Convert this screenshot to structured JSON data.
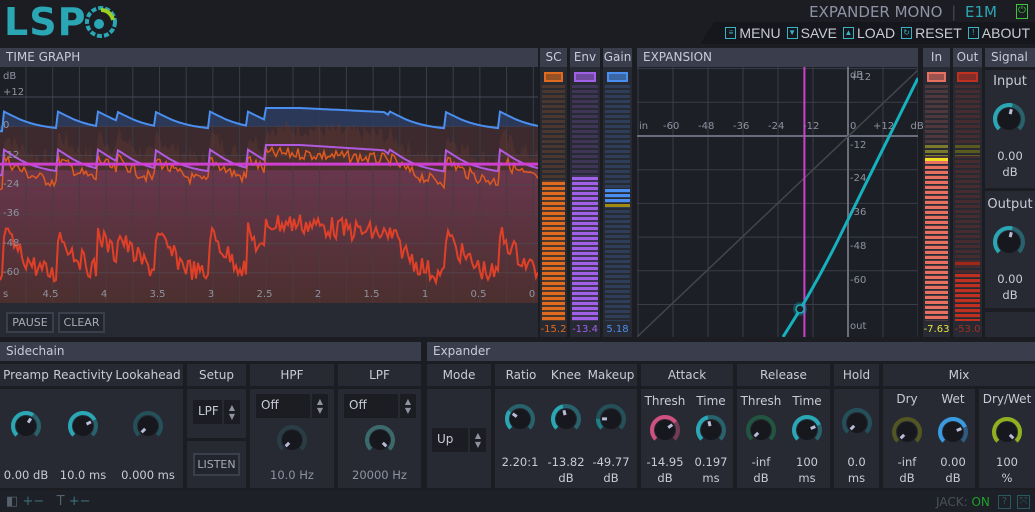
{
  "header": {
    "logo": "LSP",
    "plugin_name": "EXPANDER MONO",
    "plugin_id": "E1M",
    "power_icon": "power-icon",
    "power_color": "#3fc23f",
    "menu": [
      {
        "label": "MENU",
        "icon": "menu-icon"
      },
      {
        "label": "SAVE",
        "icon": "save-icon"
      },
      {
        "label": "LOAD",
        "icon": "load-icon"
      },
      {
        "label": "RESET",
        "icon": "reset-icon"
      },
      {
        "label": "ABOUT",
        "icon": "about-icon"
      }
    ]
  },
  "time_graph": {
    "title": "TIME GRAPH",
    "unit": "dB",
    "y_ticks": [
      "+12",
      "0",
      "-12",
      "-24",
      "-36",
      "-48",
      "-60"
    ],
    "x_unit": "s",
    "x_ticks": [
      "4.5",
      "4",
      "3.5",
      "3",
      "2.5",
      "2",
      "1.5",
      "1",
      "0.5",
      "0"
    ],
    "pause": "PAUSE",
    "clear": "CLEAR",
    "colors": {
      "sidechain": "#e05a1e",
      "envelope": "#b05ae0",
      "gain": "#4a8ff0",
      "input": "#e04028",
      "threshold": "#d040d0"
    }
  },
  "meters": {
    "sc": {
      "label": "SC",
      "value": "-15.2",
      "color": "#e06a1e",
      "level": 0.59
    },
    "env": {
      "label": "Env",
      "value": "-13.4",
      "color": "#a060e8",
      "level": 0.61
    },
    "gain": {
      "label": "Gain",
      "value": "5.18",
      "color": "#4a8ff0"
    },
    "in": {
      "label": "In",
      "value": "-7.63",
      "color": "#e87060",
      "level": 0.68,
      "value_color": "#e8e040"
    },
    "out": {
      "label": "Out",
      "value": "-53.0",
      "color": "#c03020",
      "level": 0.2,
      "value_color": "#a03020"
    }
  },
  "expansion": {
    "title": "EXPANSION",
    "unit": "dB",
    "in_label": "in",
    "out_label": "out",
    "x_ticks": [
      "-60",
      "-48",
      "-36",
      "-24",
      "-12",
      "0",
      "+12"
    ],
    "y_ticks": [
      "+12",
      "-12",
      "-24",
      "-36",
      "-48",
      "-60"
    ],
    "curve_color": "#16b0be",
    "threshold_color": "#d040d0"
  },
  "signal": {
    "title": "Signal",
    "input": {
      "label": "Input",
      "value": "0.00",
      "unit": "dB",
      "pos": 0.55
    },
    "output": {
      "label": "Output",
      "value": "0.00",
      "unit": "dB",
      "pos": 0.55
    }
  },
  "sidechain": {
    "title": "Sidechain",
    "preamp": {
      "label": "Preamp",
      "value": "0.00 dB",
      "pos": 0.62,
      "color": "#2aa6b4"
    },
    "reactivity": {
      "label": "Reactivity",
      "value": "10.0 ms",
      "pos": 0.73,
      "color": "#2aa6b4"
    },
    "lookahead": {
      "label": "Lookahead",
      "value": "0.000 ms",
      "pos": 0.0,
      "color": "#1f7f88"
    },
    "setup": {
      "label": "Setup",
      "value": "LPF",
      "listen": "LISTEN"
    },
    "hpf": {
      "label": "HPF",
      "mode": "Off",
      "value": "10.0 Hz",
      "pos": 0.0,
      "color": "#2d5558"
    },
    "lpf": {
      "label": "LPF",
      "mode": "Off",
      "value": "20000 Hz",
      "pos": 1.0,
      "color": "#3c6a6c"
    }
  },
  "expander": {
    "title": "Expander",
    "mode": {
      "label": "Mode",
      "value": "Up"
    },
    "ratio": {
      "label": "Ratio",
      "value": "2.20:1",
      "pos": 0.3,
      "color": "#2aa6b4"
    },
    "knee": {
      "label": "Knee",
      "value": "-13.82",
      "unit": "dB",
      "pos": 0.45,
      "color": "#2aa6b4"
    },
    "makeup": {
      "label": "Makeup",
      "value": "-49.77",
      "unit": "dB",
      "pos": 0.17,
      "color": "#1f7f88"
    },
    "attack": {
      "label": "Attack",
      "thresh": {
        "label": "Thresh",
        "value": "-14.95",
        "unit": "dB",
        "pos": 0.7,
        "color": "#d05080"
      },
      "time": {
        "label": "Time",
        "value": "0.197",
        "unit": "ms",
        "pos": 0.45,
        "color": "#2aa6b4"
      }
    },
    "release": {
      "label": "Release",
      "thresh": {
        "label": "Thresh",
        "value": "-inf",
        "unit": "dB",
        "pos": 0.0,
        "color": "#1a8a50"
      },
      "time": {
        "label": "Time",
        "value": "100",
        "unit": "ms",
        "pos": 0.75,
        "color": "#2aa6b4"
      }
    },
    "hold": {
      "label": "Hold",
      "value": "0.0",
      "unit": "ms",
      "pos": 0.0,
      "color": "#1f7f88"
    },
    "mix": {
      "label": "Mix",
      "dry": {
        "label": "Dry",
        "value": "-inf",
        "unit": "dB",
        "pos": 0.0,
        "color": "#8a8a10"
      },
      "wet": {
        "label": "Wet",
        "value": "0.00",
        "unit": "dB",
        "pos": 0.75,
        "color": "#3a9ae0"
      },
      "drywet": {
        "label": "Dry/Wet",
        "value": "100",
        "unit": "%",
        "pos": 1.0,
        "color": "#90b020"
      }
    }
  },
  "status": {
    "jack_label": "JACK:",
    "jack_state": "ON"
  }
}
